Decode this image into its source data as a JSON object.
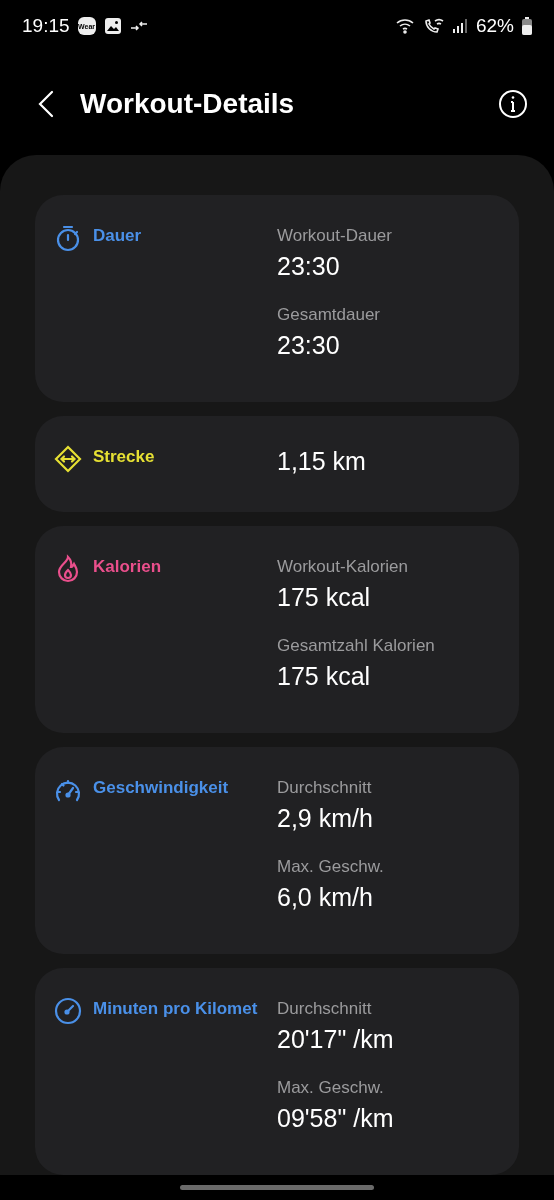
{
  "status_bar": {
    "time": "19:15",
    "app_badge": "Wear",
    "battery": "62%"
  },
  "header": {
    "title": "Workout-Details"
  },
  "cards": [
    {
      "kind": "duration",
      "title": "Dauer",
      "color": "#4a90e8",
      "metrics": [
        {
          "label": "Workout-Dauer",
          "value": "23:30"
        },
        {
          "label": "Gesamtdauer",
          "value": "23:30"
        }
      ]
    },
    {
      "kind": "distance",
      "title": "Strecke",
      "color": "#e6e033",
      "metrics": [
        {
          "value": "1,15 km"
        }
      ]
    },
    {
      "kind": "calories",
      "title": "Kalorien",
      "color": "#ea4f8c",
      "metrics": [
        {
          "label": "Workout-Kalorien",
          "value": "175 kcal"
        },
        {
          "label": "Gesamtzahl Kalorien",
          "value": "175 kcal"
        }
      ]
    },
    {
      "kind": "speed",
      "title": "Geschwindigkeit",
      "color": "#4a90e8",
      "metrics": [
        {
          "label": "Durchschnitt",
          "value": "2,9 km/h"
        },
        {
          "label": "Max. Geschw.",
          "value": "6,0 km/h"
        }
      ]
    },
    {
      "kind": "pace",
      "title": "Minuten pro Kilomet",
      "color": "#4a90e8",
      "metrics": [
        {
          "label": "Durchschnitt",
          "value": "20'17\" /km"
        },
        {
          "label": "Max. Geschw.",
          "value": "09'58\" /km"
        }
      ]
    }
  ]
}
